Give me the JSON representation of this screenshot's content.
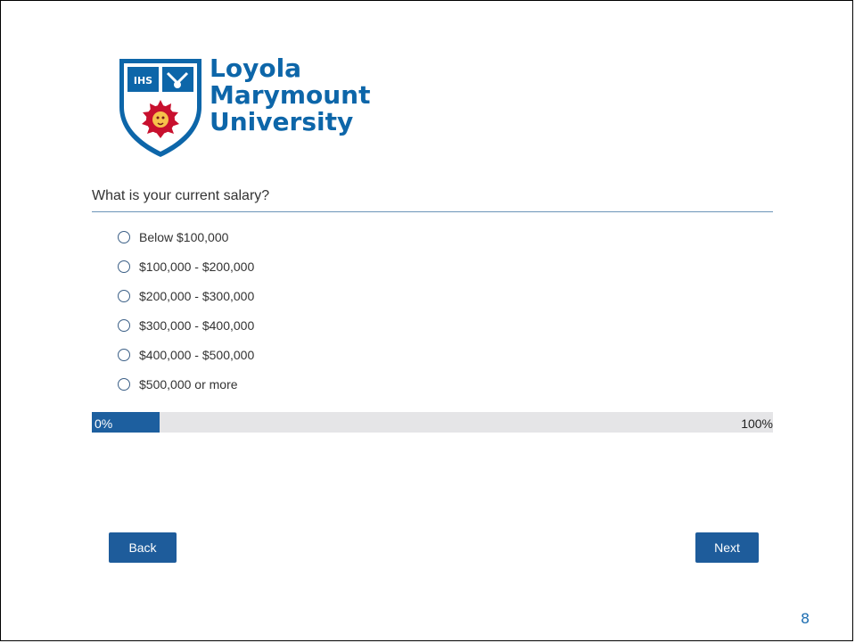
{
  "logo": {
    "name_lines": [
      "Loyola",
      "Marymount",
      "University"
    ],
    "seal_text": "IHS",
    "brand_color": "#0d66a9",
    "accent_color": "#c8102e"
  },
  "question": {
    "text": "What is your current salary?",
    "options": [
      "Below $100,000",
      "$100,000 - $200,000",
      "$200,000 - $300,000",
      "$300,000 - $400,000",
      "$400,000 - $500,000",
      "$500,000 or more"
    ]
  },
  "progress": {
    "min_label": "0%",
    "max_label": "100%",
    "fraction": 0.1
  },
  "nav": {
    "back_label": "Back",
    "next_label": "Next"
  },
  "slide": {
    "page_number": "8"
  }
}
